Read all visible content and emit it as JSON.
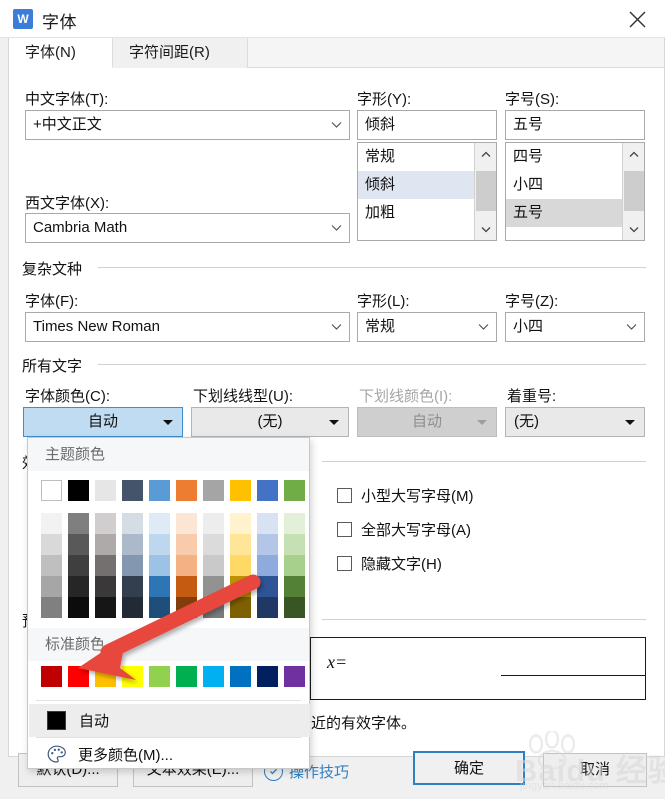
{
  "window": {
    "title": "字体",
    "icon": "wps-writer-icon",
    "icon_letter": "W",
    "close_icon": "close-icon"
  },
  "tabs": [
    {
      "label": "字体(N)",
      "active": true
    },
    {
      "label": "字符间距(R)",
      "active": false
    }
  ],
  "chinese_font": {
    "label": "中文字体(T):",
    "value": "+中文正文"
  },
  "western_font": {
    "label": "西文字体(X):",
    "value": "Cambria Math"
  },
  "font_style": {
    "label": "字形(Y):",
    "value": "倾斜",
    "options": [
      "常规",
      "倾斜",
      "加粗"
    ],
    "selected_index": 1
  },
  "font_size": {
    "label": "字号(S):",
    "value": "五号",
    "options": [
      "四号",
      "小四",
      "五号"
    ],
    "selected_index": 2
  },
  "complex_script": {
    "group_label": "复杂文种",
    "font": {
      "label": "字体(F):",
      "value": "Times New Roman"
    },
    "style": {
      "label": "字形(L):",
      "value": "常规"
    },
    "size": {
      "label": "字号(Z):",
      "value": "小四"
    }
  },
  "all_text": {
    "group_label": "所有文字",
    "font_color": {
      "label": "字体颜色(C):",
      "value": "自动",
      "active": true
    },
    "underline_style": {
      "label": "下划线线型(U):",
      "value": "(无)"
    },
    "underline_color": {
      "label": "下划线颜色(I):",
      "value": "自动",
      "disabled": true
    },
    "emphasis_mark": {
      "label": "着重号:",
      "value": "(无)"
    }
  },
  "effects": {
    "group_label": "效果",
    "checkboxes": [
      {
        "label": "小型大写字母(M)",
        "checked": false
      },
      {
        "label": "全部大写字母(A)",
        "checked": false
      },
      {
        "label": "隐藏文字(H)",
        "checked": false
      }
    ]
  },
  "preview": {
    "group_label": "预览",
    "sample_text": "x=",
    "note": "近的有效字体。"
  },
  "color_panel": {
    "theme_header": "主题颜色",
    "standard_header": "标准颜色",
    "theme_base": [
      "#FFFFFF",
      "#000000",
      "#E7E6E6",
      "#44546A",
      "#5B9BD5",
      "#ED7D31",
      "#A5A5A5",
      "#FFC000",
      "#4472C4",
      "#70AD47"
    ],
    "theme_variants": [
      [
        "#F2F2F2",
        "#7F7F7F",
        "#D0CECE",
        "#D6DCE4",
        "#DEEAF6",
        "#FBE5D5",
        "#EDEDED",
        "#FFF2CC",
        "#D9E2F3",
        "#E2EFD9"
      ],
      [
        "#D9D9D9",
        "#595959",
        "#AEAAAA",
        "#ACB9CA",
        "#BDD7EE",
        "#F8CBAD",
        "#DBDBDB",
        "#FFE598",
        "#B4C6E7",
        "#C5E0B3"
      ],
      [
        "#BFBFBF",
        "#3F3F3F",
        "#757070",
        "#8497B0",
        "#9CC3E5",
        "#F4B183",
        "#C9C9C9",
        "#FFD965",
        "#8FAADC",
        "#A8D08D"
      ],
      [
        "#A6A6A6",
        "#262626",
        "#3A3838",
        "#333F4F",
        "#2E75B5",
        "#C55A11",
        "#929292",
        "#BF9000",
        "#2F5496",
        "#538135"
      ],
      [
        "#808080",
        "#0C0C0C",
        "#171616",
        "#222A35",
        "#1F4E79",
        "#833C0B",
        "#7B7B7B",
        "#7F6000",
        "#1F3864",
        "#375623"
      ]
    ],
    "standard_colors": [
      "#C00000",
      "#FF0000",
      "#FFC000",
      "#FFFF00",
      "#92D050",
      "#00B050",
      "#00B0F0",
      "#0070C0",
      "#002060",
      "#7030A0"
    ],
    "menu_items": [
      {
        "label": "自动",
        "icon": "black-square-icon",
        "hovered": true
      },
      {
        "label": "更多颜色(M)...",
        "icon": "palette-icon",
        "hovered": false
      }
    ]
  },
  "footer": {
    "default_button": "默认(D)...",
    "text_effects_button": "文本效果(E)...",
    "tips_link": "操作技巧",
    "ok_button": "确定",
    "cancel_button": "取消"
  },
  "annotation": {
    "arrow_color": "#E8463C",
    "arrow_name": "red-pointer-arrow"
  },
  "watermark": {
    "brand": "Baidu 经验",
    "url": "jingyan.baidu.com"
  }
}
